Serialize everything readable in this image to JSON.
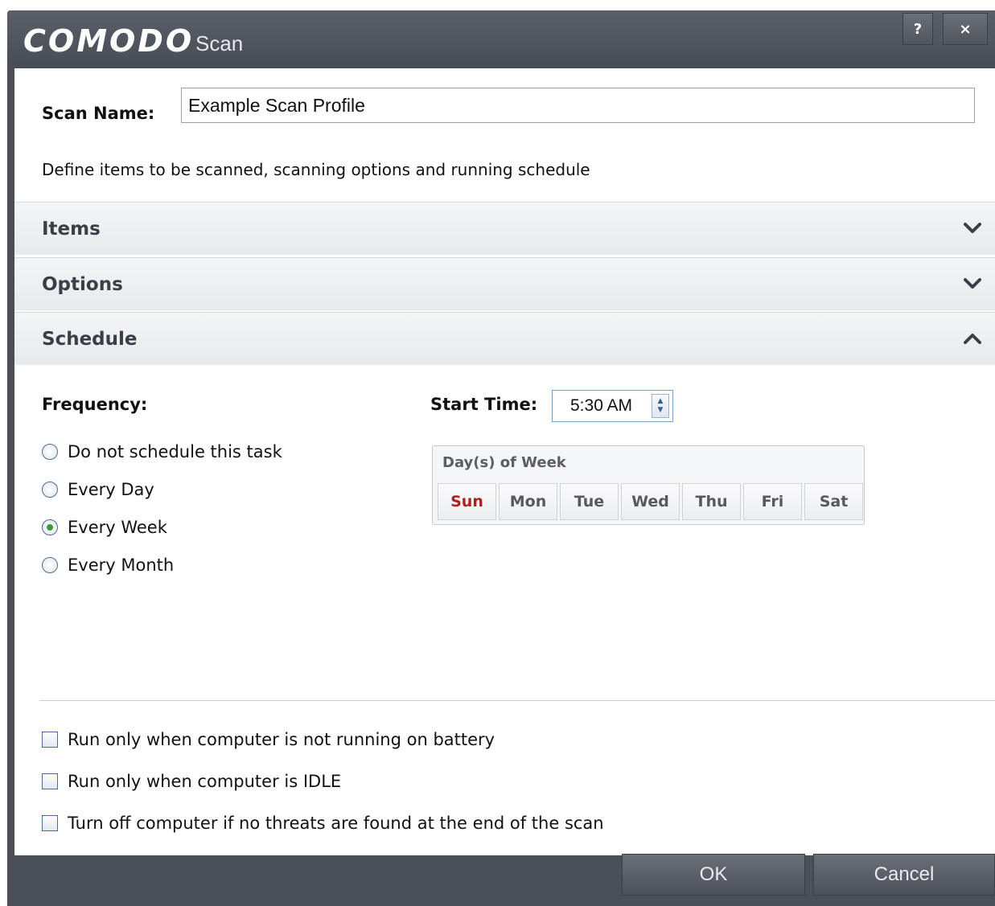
{
  "window": {
    "brand": "COMODO",
    "title": "Scan",
    "help_label": "?",
    "close_label": "×"
  },
  "scan_name": {
    "label": "Scan Name:",
    "value": "Example Scan Profile"
  },
  "description": "Define items to be scanned, scanning options and running schedule",
  "sections": {
    "items": {
      "label": "Items",
      "state": "collapsed"
    },
    "options": {
      "label": "Options",
      "state": "collapsed"
    },
    "schedule": {
      "label": "Schedule",
      "state": "expanded"
    }
  },
  "schedule": {
    "frequency_label": "Frequency:",
    "frequency_options": [
      {
        "label": "Do not schedule this task",
        "selected": false
      },
      {
        "label": "Every Day",
        "selected": false
      },
      {
        "label": "Every Week",
        "selected": true
      },
      {
        "label": "Every Month",
        "selected": false
      }
    ],
    "start_time_label": "Start Time:",
    "start_time_value": "5:30 AM",
    "days_title": "Day(s) of Week",
    "days": [
      "Sun",
      "Mon",
      "Tue",
      "Wed",
      "Thu",
      "Fri",
      "Sat"
    ],
    "selected_day": "Sun"
  },
  "conditions": [
    {
      "label": "Run only when computer is not running on battery",
      "checked": false
    },
    {
      "label": "Run only when computer is IDLE",
      "checked": false
    },
    {
      "label": "Turn off computer if no threats are found at the end of the scan",
      "checked": false
    }
  ],
  "footer": {
    "ok_label": "OK",
    "cancel_label": "Cancel"
  },
  "colors": {
    "titlebar": "#4a4f58",
    "selected_day": "#b02020",
    "radio_selected": "#3a9a3a"
  }
}
